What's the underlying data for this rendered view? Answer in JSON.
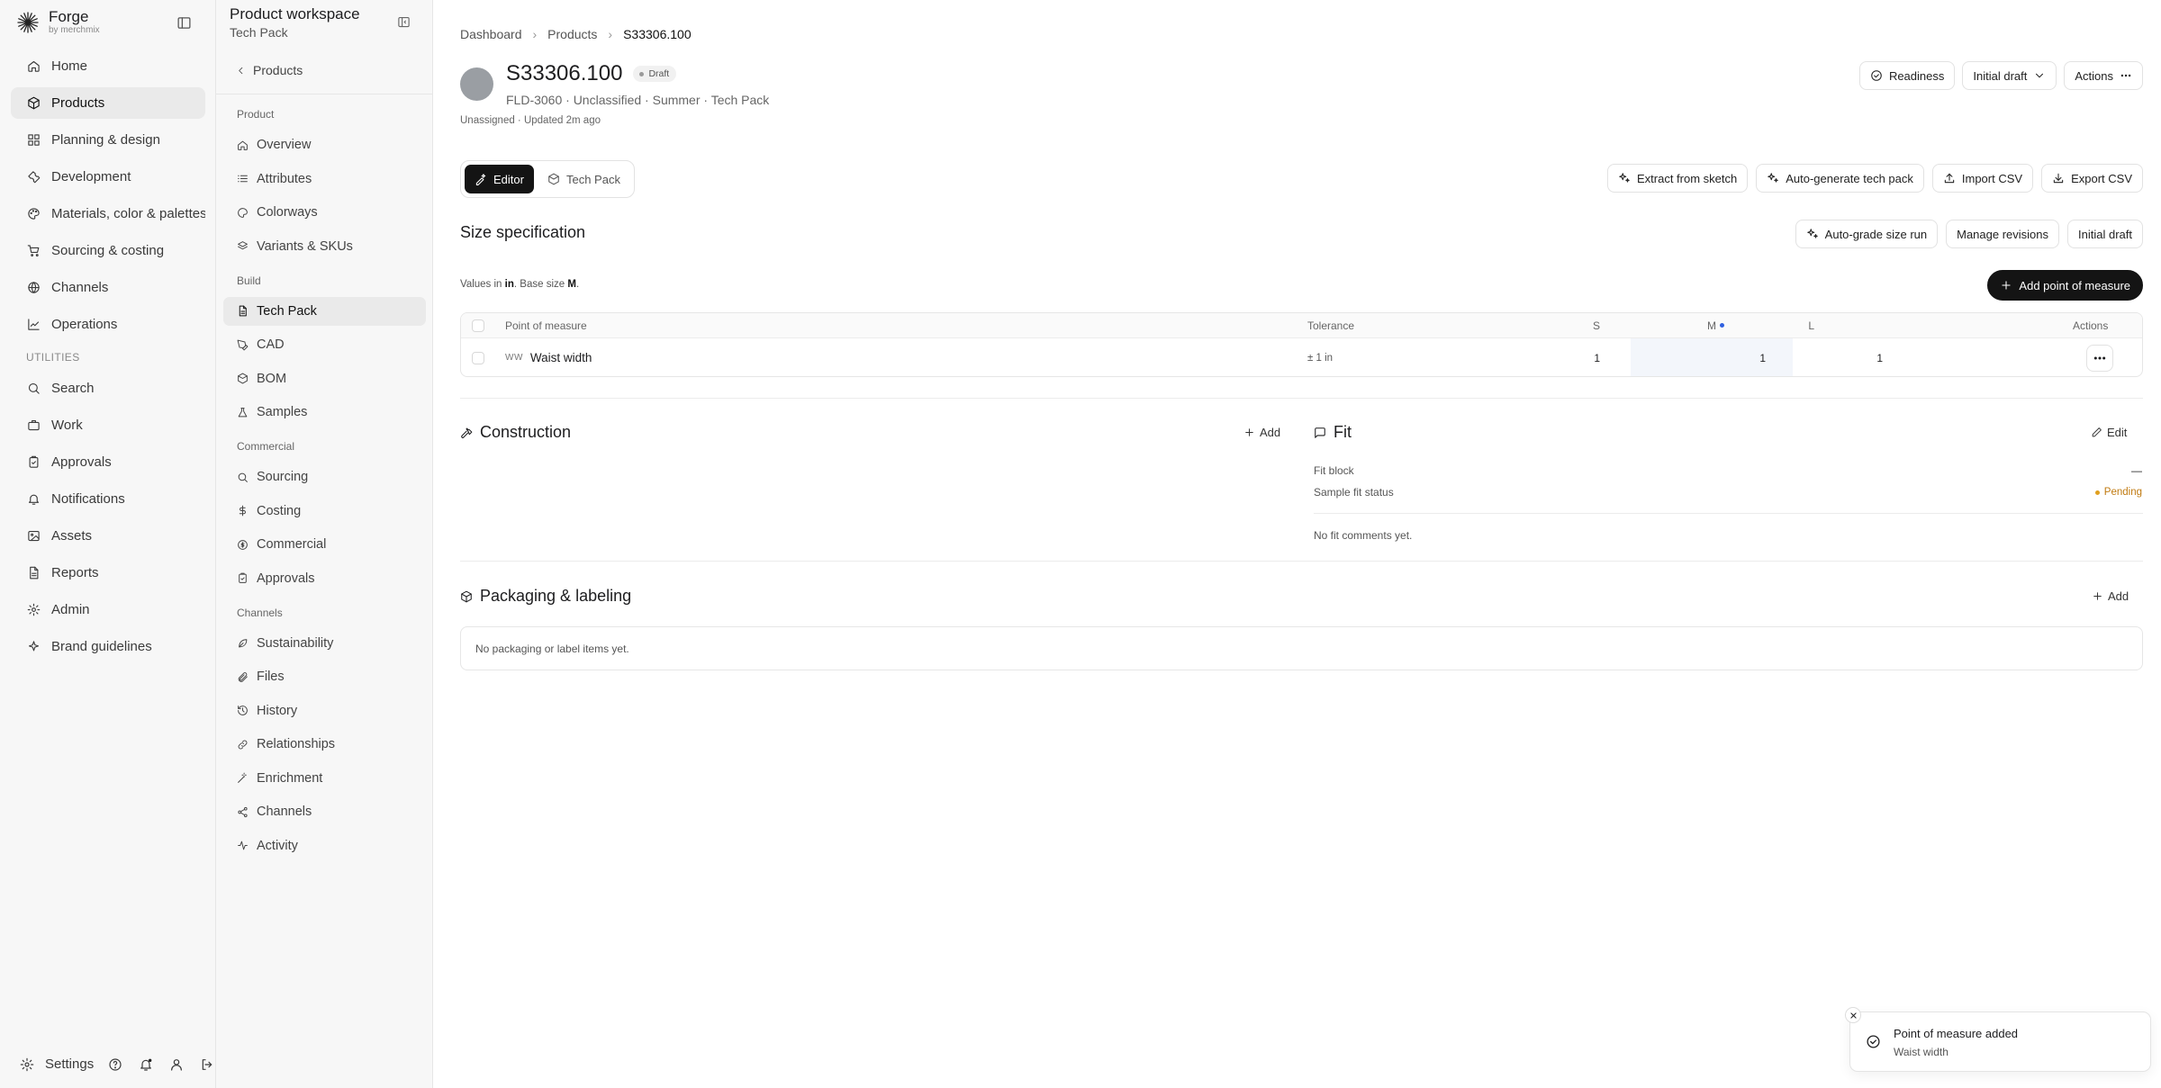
{
  "brand": {
    "name": "Forge",
    "sub": "by merchmix"
  },
  "nav": {
    "items": [
      {
        "label": "Home",
        "icon": "home-icon"
      },
      {
        "label": "Products",
        "icon": "box-icon"
      },
      {
        "label": "Planning & design",
        "icon": "grid-icon"
      },
      {
        "label": "Development",
        "icon": "wrench-icon"
      },
      {
        "label": "Materials, color & palettes",
        "icon": "palette-icon"
      },
      {
        "label": "Sourcing & costing",
        "icon": "cart-icon"
      },
      {
        "label": "Channels",
        "icon": "globe-icon"
      },
      {
        "label": "Operations",
        "icon": "chart-icon"
      }
    ],
    "utilities_label": "UTILITIES",
    "utilities": [
      {
        "label": "Search",
        "icon": "search-icon"
      },
      {
        "label": "Work",
        "icon": "briefcase-icon"
      },
      {
        "label": "Approvals",
        "icon": "clipboard-check-icon"
      },
      {
        "label": "Notifications",
        "icon": "bell-icon"
      },
      {
        "label": "Assets",
        "icon": "image-icon"
      },
      {
        "label": "Reports",
        "icon": "file-icon"
      },
      {
        "label": "Admin",
        "icon": "gear-icon"
      },
      {
        "label": "Brand guidelines",
        "icon": "sparkle-icon"
      }
    ],
    "settings_label": "Settings"
  },
  "subnav": {
    "title": "Product workspace",
    "subtitle": "Tech Pack",
    "back": "Products",
    "sections": [
      {
        "label": "Product",
        "items": [
          "Overview",
          "Attributes",
          "Colorways",
          "Variants & SKUs"
        ]
      },
      {
        "label": "Build",
        "items": [
          "Tech Pack",
          "CAD",
          "BOM",
          "Samples"
        ]
      },
      {
        "label": "Commercial",
        "items": [
          "Sourcing",
          "Costing",
          "Commercial",
          "Approvals"
        ]
      },
      {
        "label": "Channels",
        "items": [
          "Sustainability",
          "Files",
          "History",
          "Relationships",
          "Enrichment",
          "Channels",
          "Activity"
        ]
      }
    ]
  },
  "breadcrumb": [
    "Dashboard",
    "Products",
    "S33306.100"
  ],
  "product": {
    "title": "S33306.100",
    "status": "Draft",
    "meta": "FLD-3060 · Unclassified · Summer · Tech Pack",
    "assign": "Unassigned · Updated 2m ago"
  },
  "header_actions": {
    "readiness": "Readiness",
    "version": "Initial draft",
    "actions": "Actions"
  },
  "modes": {
    "editor": "Editor",
    "techpack": "Tech Pack"
  },
  "tools": {
    "extract": "Extract from sketch",
    "autogen": "Auto-generate tech pack",
    "import": "Import CSV",
    "export": "Export CSV"
  },
  "size_spec": {
    "title": "Size specification",
    "autograde": "Auto-grade size run",
    "revisions": "Manage revisions",
    "version": "Initial draft",
    "note_prefix": "Values in ",
    "unit": "in",
    "note_mid": ". Base size ",
    "base_size": "M",
    "note_suffix": ".",
    "add_pom": "Add point of measure",
    "columns": {
      "pom": "Point of measure",
      "tolerance": "Tolerance",
      "s": "S",
      "m": "M",
      "l": "L",
      "actions": "Actions"
    },
    "rows": [
      {
        "code": "WW",
        "name": "Waist width",
        "tolerance": "± 1 in",
        "s": "1",
        "m": "1",
        "l": "1"
      }
    ]
  },
  "construction": {
    "title": "Construction",
    "add": "Add"
  },
  "fit": {
    "title": "Fit",
    "edit": "Edit",
    "fit_block_label": "Fit block",
    "fit_block_value": "—",
    "status_label": "Sample fit status",
    "status_value": "Pending",
    "empty": "No fit comments yet."
  },
  "packaging": {
    "title": "Packaging & labeling",
    "add": "Add",
    "empty": "No packaging or label items yet."
  },
  "toast": {
    "title": "Point of measure added",
    "subtitle": "Waist width"
  },
  "colors": {
    "accent": "#141414",
    "base_highlight": "#f3f6fb",
    "pending": "#e0a020",
    "base_dot": "#3060e0"
  }
}
